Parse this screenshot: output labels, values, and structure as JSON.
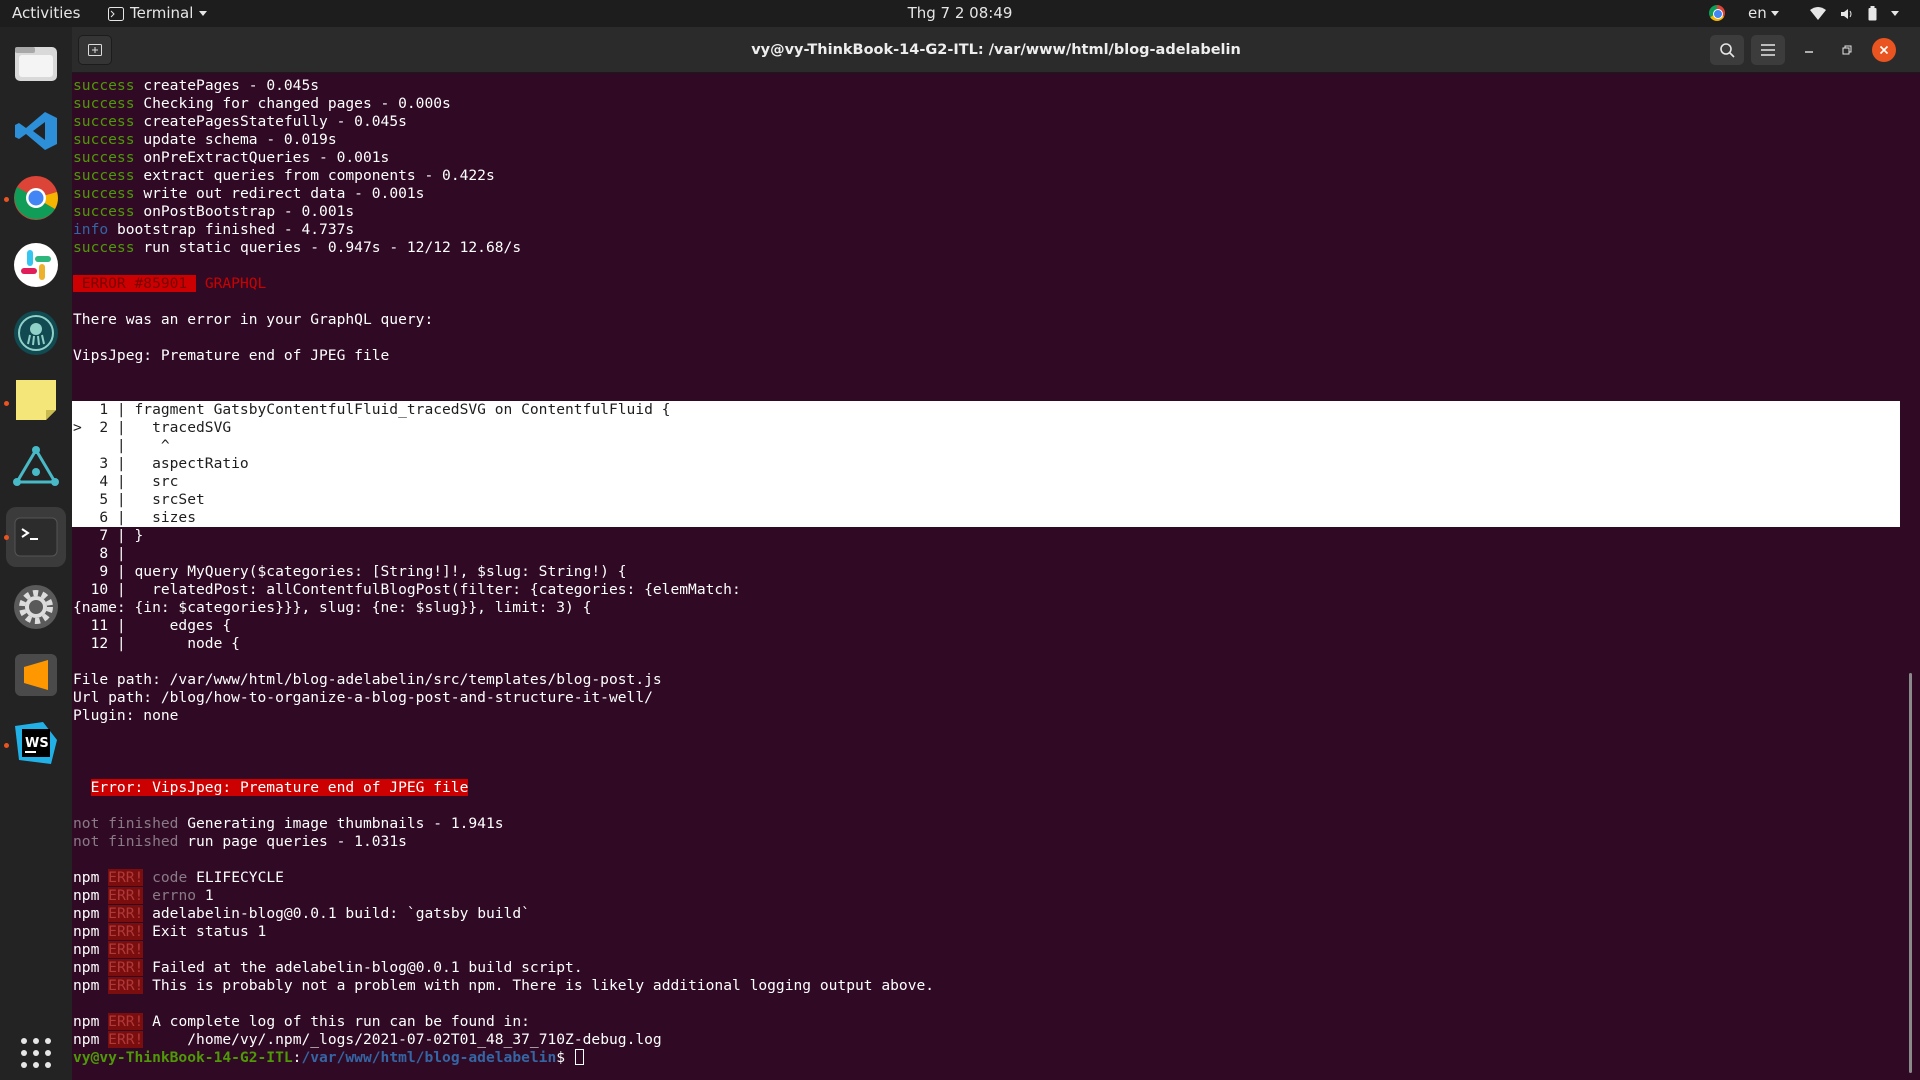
{
  "topbar": {
    "activities": "Activities",
    "app_name": "Terminal",
    "clock": "Thg 7 2  08:49",
    "language": "en",
    "icons": [
      "chrome-tray-icon",
      "wifi-icon",
      "battery-icon",
      "power-menu-icon"
    ]
  },
  "dock": {
    "apps": [
      "files",
      "visual-studio-code",
      "google-chrome",
      "slack",
      "gitkraken",
      "sticky-notes",
      "gnome-network",
      "terminal",
      "settings",
      "sublime-text",
      "webstorm"
    ],
    "show_apps_label": "show-applications"
  },
  "window": {
    "title": "vy@vy-ThinkBook-14-G2-ITL: /var/www/html/blog-adelabelin"
  },
  "terminal": {
    "success_label": "success",
    "info_label": "info",
    "not_finished_label": "not finished",
    "steps": [
      "createPages - 0.045s",
      "Checking for changed pages - 0.000s",
      "createPagesStatefully - 0.045s",
      "update schema - 0.019s",
      "onPreExtractQueries - 0.001s",
      "extract queries from components - 0.422s",
      "write out redirect data - 0.001s",
      "onPostBootstrap - 0.001s"
    ],
    "info_line": "bootstrap finished - 4.737s",
    "static_queries": "run static queries - 0.947s - 12/12 12.68/s",
    "error_badge": " ERROR #85901 ",
    "error_category": "GRAPHQL",
    "error_msg": "There was an error in your GraphQL query:",
    "vips_msg": "VipsJpeg: Premature end of JPEG file",
    "code_lines": [
      "   1 | fragment GatsbyContentfulFluid_tracedSVG on ContentfulFluid {",
      ">  2 |   tracedSVG",
      "     |    ^",
      "   3 |   aspectRatio",
      "   4 |   src",
      "   5 |   srcSet",
      "   6 |   sizes",
      "   7 | }",
      "   8 |",
      "   9 | query MyQuery($categories: [String!]!, $slug: String!) {",
      "  10 |   relatedPost: allContentfulBlogPost(filter: {categories: {elemMatch:",
      "{name: {in: $categories}}}, slug: {ne: $slug}}, limit: 3) {",
      "  11 |     edges {",
      "  12 |       node {"
    ],
    "file_path": "File path: /var/www/html/blog-adelabelin/src/templates/blog-post.js",
    "url_path": "Url path: /blog/how-to-organize-a-blog-post-and-structure-it-well/",
    "plugin": "Plugin: none",
    "error_banner": "Error: VipsJpeg: Premature end of JPEG file",
    "not_finished": [
      "Generating image thumbnails - 1.941s",
      "run page queries - 1.031s"
    ],
    "npm_prefix": "npm",
    "npm_err": "ERR!",
    "npm_lines": [
      {
        "key": "code",
        "val": "ELIFECYCLE"
      },
      {
        "key": "errno",
        "val": "1"
      },
      {
        "key": "",
        "val": "adelabelin-blog@0.0.1 build: `gatsby build`"
      },
      {
        "key": "",
        "val": "Exit status 1"
      },
      {
        "key": "",
        "val": ""
      },
      {
        "key": "",
        "val": "Failed at the adelabelin-blog@0.0.1 build script."
      },
      {
        "key": "",
        "val": "This is probably not a problem with npm. There is likely additional logging output above."
      },
      {
        "key": "",
        "val": ""
      },
      {
        "key": "",
        "val": "A complete log of this run can be found in:"
      },
      {
        "key": "",
        "val": "    /home/vy/.npm/_logs/2021-07-02T01_48_37_710Z-debug.log"
      }
    ],
    "prompt_user": "vy@vy-ThinkBook-14-G2-ITL",
    "prompt_sep": ":",
    "prompt_path": "/var/www/html/blog-adelabelin",
    "prompt_symbol": "$ "
  }
}
